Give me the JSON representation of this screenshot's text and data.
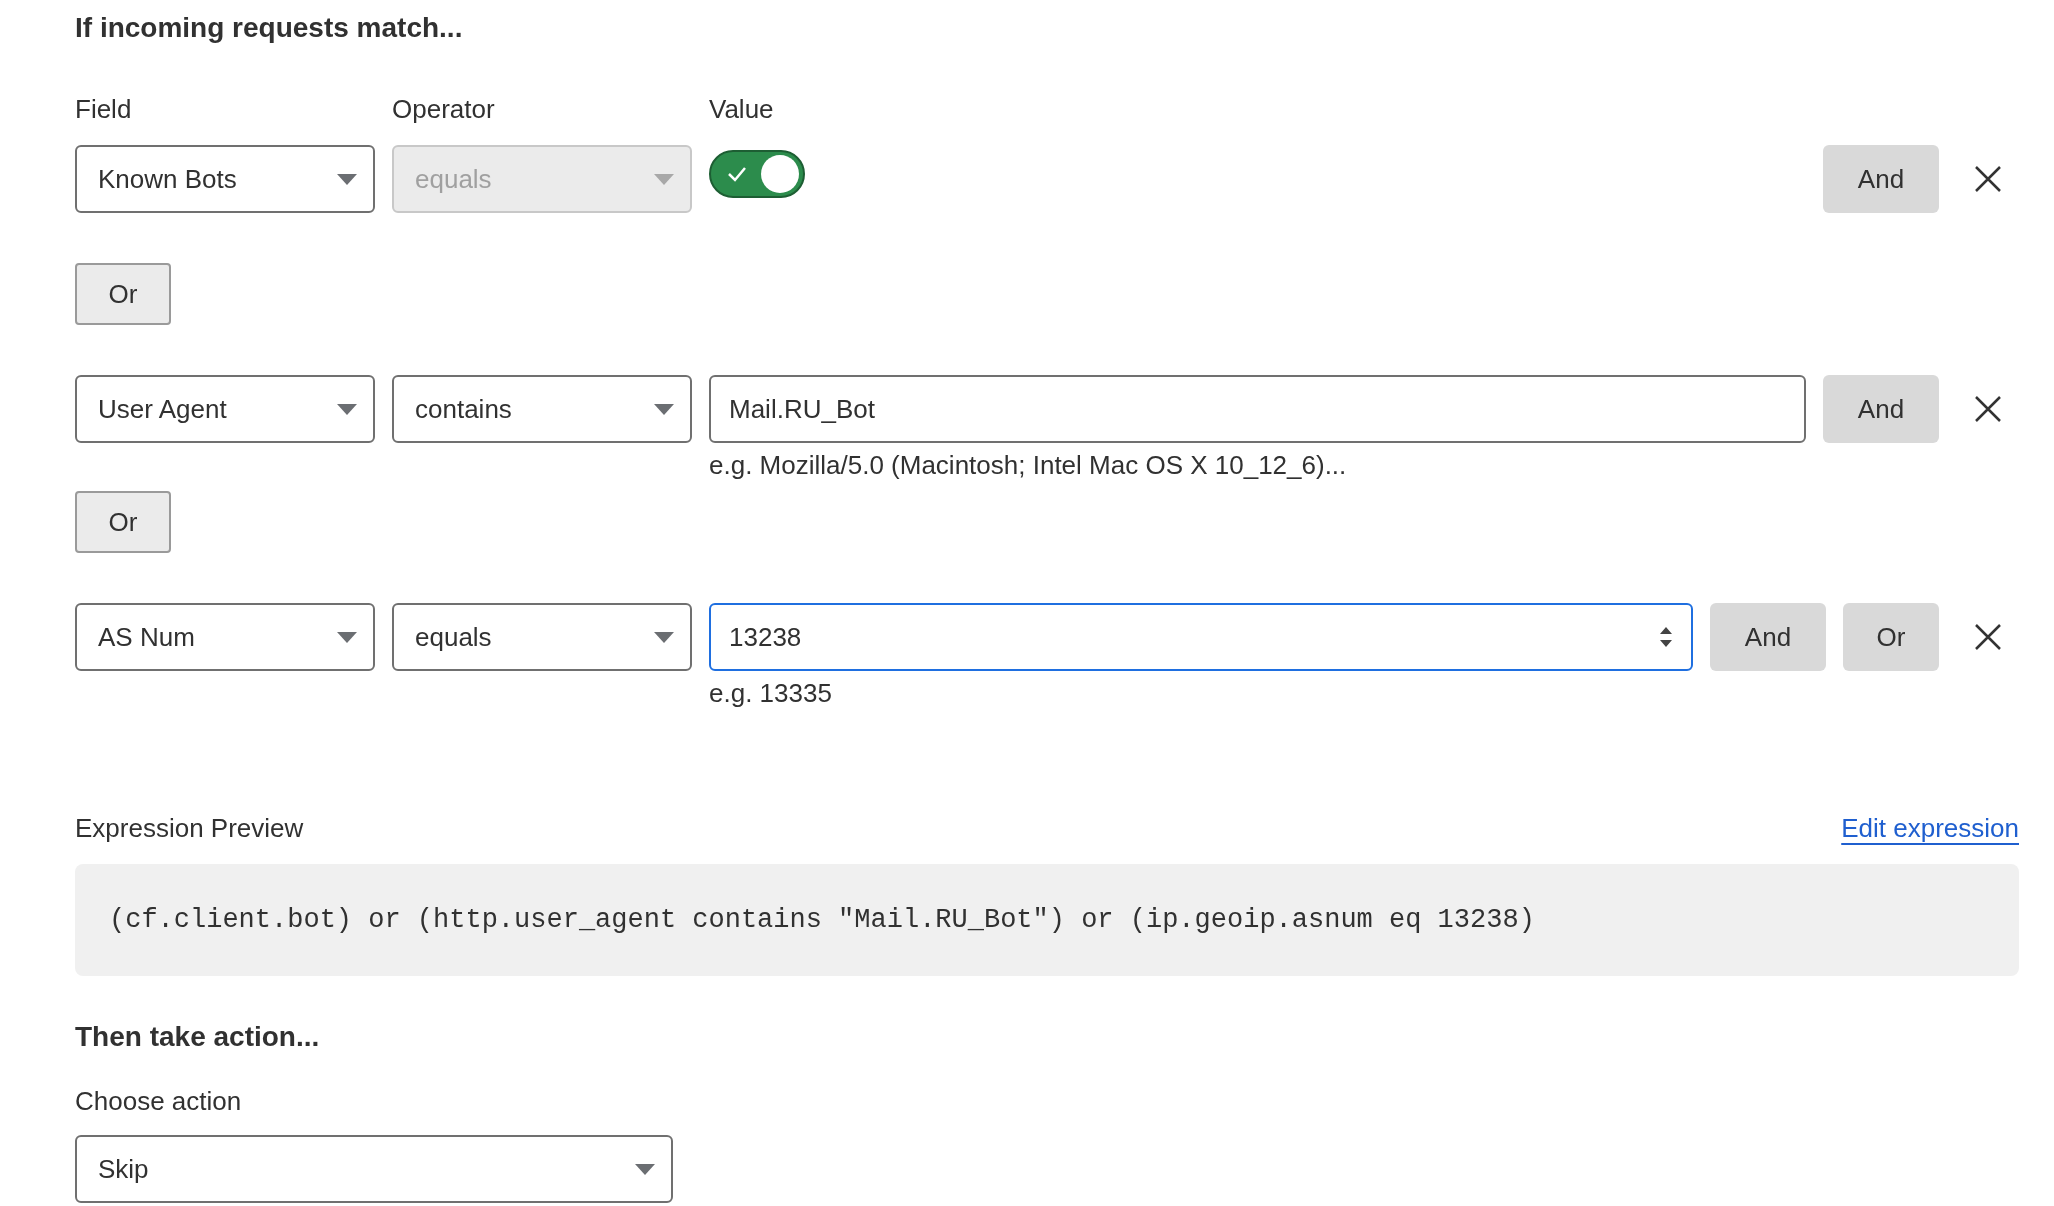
{
  "heading": "If incoming requests match...",
  "column_labels": [
    "Field",
    "Operator",
    "Value"
  ],
  "items": [
    {
      "kind": "condition",
      "field": "Known Bots",
      "operator": {
        "value": "equals",
        "disabled": true
      },
      "value": {
        "kind": "toggle",
        "on": true
      },
      "buttons": [
        "And"
      ]
    },
    {
      "kind": "or",
      "label": "Or"
    },
    {
      "kind": "condition",
      "field": "User Agent",
      "operator": {
        "value": "contains",
        "disabled": false
      },
      "value": {
        "kind": "text",
        "text": "Mail.RU_Bot",
        "focused": false
      },
      "hint": "e.g. Mozilla/5.0 (Macintosh; Intel Mac OS X 10_12_6)...",
      "buttons": [
        "And"
      ]
    },
    {
      "kind": "or",
      "label": "Or"
    },
    {
      "kind": "condition",
      "field": "AS Num",
      "operator": {
        "value": "equals",
        "disabled": false
      },
      "value": {
        "kind": "number",
        "text": "13238",
        "focused": true
      },
      "hint": "e.g. 13335",
      "buttons": [
        "And",
        "Or"
      ]
    }
  ],
  "expression": {
    "label": "Expression Preview",
    "link": "Edit expression",
    "code": "(cf.client.bot) or (http.user_agent contains \"Mail.RU_Bot\") or (ip.geoip.asnum eq 13238)"
  },
  "action": {
    "heading": "Then take action...",
    "label": "Choose action",
    "value": "Skip"
  }
}
